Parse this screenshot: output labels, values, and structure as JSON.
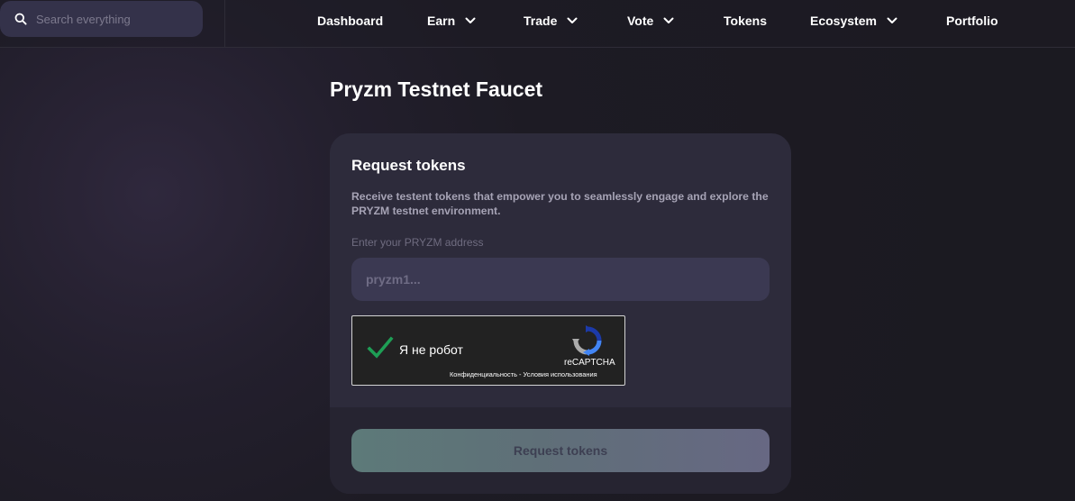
{
  "header": {
    "search": {
      "placeholder": "Search everything",
      "value": ""
    },
    "nav": [
      {
        "label": "Dashboard",
        "has_dropdown": false
      },
      {
        "label": "Earn",
        "has_dropdown": true
      },
      {
        "label": "Trade",
        "has_dropdown": true
      },
      {
        "label": "Vote",
        "has_dropdown": true
      },
      {
        "label": "Tokens",
        "has_dropdown": false
      },
      {
        "label": "Ecosystem",
        "has_dropdown": true
      },
      {
        "label": "Portfolio",
        "has_dropdown": false
      }
    ]
  },
  "page": {
    "title": "Pryzm Testnet Faucet"
  },
  "card": {
    "title": "Request tokens",
    "description": "Receive testent tokens that empower you to seamlessly engage and explore the PRYZM testnet environment.",
    "address_label": "Enter your PRYZM address",
    "address_placeholder": "pryzm1...",
    "address_value": "",
    "submit_label": "Request tokens",
    "submit_enabled": false
  },
  "captcha": {
    "checked": true,
    "label": "Я не робот",
    "brand": "reCAPTCHA",
    "privacy_link": "Конфиденциальность",
    "separator": " - ",
    "terms_link": "Условия использования"
  },
  "colors": {
    "background": "#1d1b24",
    "card": "#2d2b3b",
    "input": "#3b3952",
    "check": "#1e9e55",
    "button_gradient_start": "#5d7a79",
    "button_gradient_end": "#676883"
  }
}
